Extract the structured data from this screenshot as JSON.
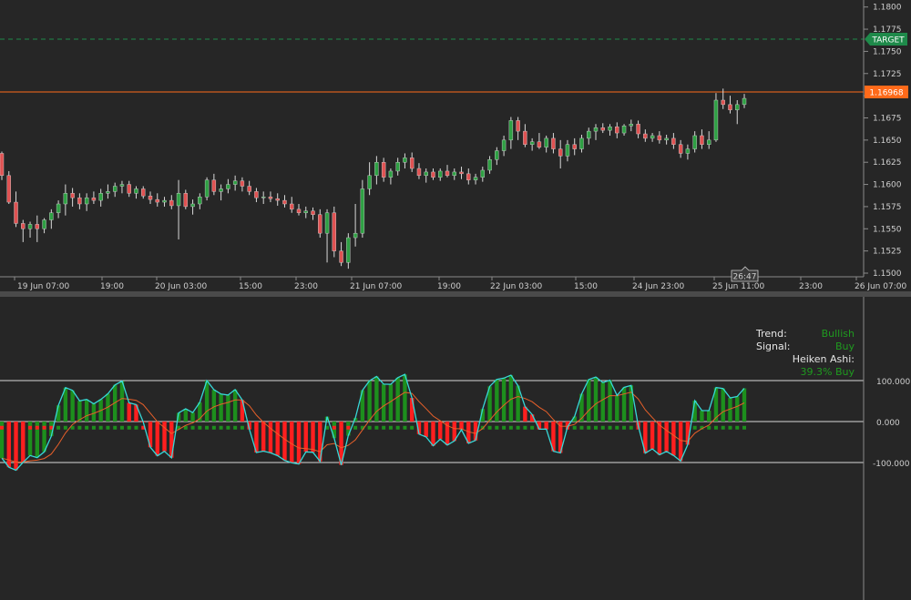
{
  "price_axis": {
    "ticks": [
      "1.1800",
      "1.1775",
      "1.1750",
      "1.1725",
      "1.1700",
      "1.1675",
      "1.1650",
      "1.1625",
      "1.1600",
      "1.1575",
      "1.1550",
      "1.1525",
      "1.1500"
    ]
  },
  "time_axis": {
    "ticks": [
      "19 Jun 07:00",
      "19:00",
      "20 Jun 03:00",
      "15:00",
      "23:00",
      "21 Jun 07:00",
      "19:00",
      "22 Jun 03:00",
      "15:00",
      "24 Jun 23:00",
      "25 Jun 11:00",
      "23:00",
      "26 Jun 07:00"
    ]
  },
  "target_label": "TARGET",
  "price_label": "1.16968",
  "countdown": "26:47",
  "osc_axis": {
    "ticks": [
      "100.000",
      "0.000",
      "-100.000"
    ]
  },
  "info_panel": {
    "trend_label": "Trend:",
    "trend_value": "Bullish",
    "signal_label": "Signal:",
    "signal_value": "Buy",
    "heiken_label": "Heiken Ashi:",
    "heiken_value": "39.3%  Buy"
  },
  "colors": {
    "background": "#262626",
    "bull": "#2ea043",
    "bear": "#e05252",
    "target": "#1e8a4a",
    "price_line": "#ff6a1a",
    "hist_green": "#1d8f1d",
    "hist_red": "#ff1f1f",
    "osc_fast": "#37d8d8",
    "osc_slow": "#e8602a"
  },
  "chart_data": {
    "type": "candlestick",
    "symbol_price_range": [
      1.15,
      1.1812
    ],
    "current_price": 1.16968,
    "target": 1.1753,
    "candles": [
      [
        1.1635,
        1.1637,
        1.1605,
        1.161
      ],
      [
        1.161,
        1.1615,
        1.1578,
        1.158
      ],
      [
        1.158,
        1.1592,
        1.1552,
        1.1556
      ],
      [
        1.1556,
        1.156,
        1.1535,
        1.155
      ],
      [
        1.155,
        1.1558,
        1.154,
        1.1555
      ],
      [
        1.1555,
        1.1565,
        1.1535,
        1.155
      ],
      [
        1.155,
        1.1562,
        1.1545,
        1.156
      ],
      [
        1.156,
        1.1572,
        1.155,
        1.1568
      ],
      [
        1.1568,
        1.1582,
        1.1562,
        1.1578
      ],
      [
        1.1578,
        1.16,
        1.1565,
        1.159
      ],
      [
        1.159,
        1.1596,
        1.1575,
        1.1585
      ],
      [
        1.1585,
        1.159,
        1.1572,
        1.1578
      ],
      [
        1.1578,
        1.159,
        1.157,
        1.1585
      ],
      [
        1.1585,
        1.1592,
        1.1578,
        1.1582
      ],
      [
        1.1582,
        1.1595,
        1.1575,
        1.159
      ],
      [
        1.159,
        1.16,
        1.1584,
        1.1592
      ],
      [
        1.1592,
        1.1602,
        1.1586,
        1.1598
      ],
      [
        1.1598,
        1.1604,
        1.159,
        1.16
      ],
      [
        1.16,
        1.1604,
        1.1586,
        1.159
      ],
      [
        1.159,
        1.1598,
        1.1584,
        1.1595
      ],
      [
        1.1595,
        1.1598,
        1.1584,
        1.1587
      ],
      [
        1.1587,
        1.1592,
        1.1578,
        1.1583
      ],
      [
        1.1583,
        1.159,
        1.1575,
        1.158
      ],
      [
        1.158,
        1.1586,
        1.1575,
        1.1582
      ],
      [
        1.1582,
        1.1588,
        1.1572,
        1.1576
      ],
      [
        1.1576,
        1.1605,
        1.1538,
        1.159
      ],
      [
        1.159,
        1.1594,
        1.1572,
        1.1575
      ],
      [
        1.1575,
        1.1583,
        1.1566,
        1.1578
      ],
      [
        1.1578,
        1.159,
        1.1572,
        1.1586
      ],
      [
        1.1586,
        1.1608,
        1.1582,
        1.1605
      ],
      [
        1.1605,
        1.1612,
        1.1588,
        1.1592
      ],
      [
        1.1592,
        1.16,
        1.1582,
        1.1595
      ],
      [
        1.1595,
        1.1606,
        1.159,
        1.16
      ],
      [
        1.16,
        1.161,
        1.1593,
        1.1604
      ],
      [
        1.1604,
        1.1608,
        1.1592,
        1.1598
      ],
      [
        1.1598,
        1.1604,
        1.1588,
        1.1592
      ],
      [
        1.1592,
        1.1596,
        1.158,
        1.1585
      ],
      [
        1.1585,
        1.1592,
        1.1578,
        1.1586
      ],
      [
        1.1586,
        1.1592,
        1.158,
        1.1584
      ],
      [
        1.1584,
        1.159,
        1.1576,
        1.1582
      ],
      [
        1.1582,
        1.1588,
        1.1574,
        1.1578
      ],
      [
        1.1578,
        1.1586,
        1.1568,
        1.1572
      ],
      [
        1.1572,
        1.1578,
        1.1565,
        1.1568
      ],
      [
        1.1568,
        1.1575,
        1.1562,
        1.157
      ],
      [
        1.157,
        1.1574,
        1.156,
        1.1566
      ],
      [
        1.1566,
        1.1572,
        1.154,
        1.1545
      ],
      [
        1.1545,
        1.1572,
        1.1512,
        1.1568
      ],
      [
        1.1568,
        1.1575,
        1.1518,
        1.1525
      ],
      [
        1.1525,
        1.1535,
        1.1508,
        1.1512
      ],
      [
        1.1512,
        1.1545,
        1.1505,
        1.154
      ],
      [
        1.154,
        1.1578,
        1.153,
        1.1545
      ],
      [
        1.1545,
        1.1605,
        1.154,
        1.1595
      ],
      [
        1.1595,
        1.1625,
        1.1588,
        1.161
      ],
      [
        1.161,
        1.1632,
        1.16,
        1.1625
      ],
      [
        1.1625,
        1.163,
        1.1603,
        1.1608
      ],
      [
        1.1608,
        1.1618,
        1.16,
        1.1615
      ],
      [
        1.1615,
        1.163,
        1.161,
        1.1625
      ],
      [
        1.1625,
        1.1635,
        1.1618,
        1.163
      ],
      [
        1.163,
        1.1636,
        1.1614,
        1.1618
      ],
      [
        1.1618,
        1.1624,
        1.1606,
        1.161
      ],
      [
        1.161,
        1.1618,
        1.1602,
        1.1614
      ],
      [
        1.1614,
        1.1618,
        1.1605,
        1.1608
      ],
      [
        1.1608,
        1.1618,
        1.1604,
        1.1615
      ],
      [
        1.1615,
        1.1622,
        1.1608,
        1.161
      ],
      [
        1.161,
        1.1618,
        1.1605,
        1.1614
      ],
      [
        1.1614,
        1.162,
        1.1606,
        1.1612
      ],
      [
        1.1612,
        1.1618,
        1.16,
        1.1605
      ],
      [
        1.1605,
        1.1612,
        1.16,
        1.1608
      ],
      [
        1.1608,
        1.162,
        1.1603,
        1.1616
      ],
      [
        1.1616,
        1.1632,
        1.1612,
        1.1628
      ],
      [
        1.1628,
        1.1642,
        1.1622,
        1.1638
      ],
      [
        1.1638,
        1.1655,
        1.1632,
        1.165
      ],
      [
        1.165,
        1.1676,
        1.164,
        1.1672
      ],
      [
        1.1672,
        1.1676,
        1.165,
        1.166
      ],
      [
        1.166,
        1.1668,
        1.1642,
        1.1645
      ],
      [
        1.1645,
        1.1652,
        1.1638,
        1.1648
      ],
      [
        1.1648,
        1.1658,
        1.164,
        1.1642
      ],
      [
        1.1642,
        1.1655,
        1.1636,
        1.1652
      ],
      [
        1.1652,
        1.1658,
        1.1635,
        1.164
      ],
      [
        1.164,
        1.165,
        1.1618,
        1.1632
      ],
      [
        1.1632,
        1.165,
        1.1626,
        1.1645
      ],
      [
        1.1645,
        1.1652,
        1.1633,
        1.164
      ],
      [
        1.164,
        1.1656,
        1.1636,
        1.1652
      ],
      [
        1.1652,
        1.1664,
        1.1645,
        1.166
      ],
      [
        1.166,
        1.1668,
        1.165,
        1.1664
      ],
      [
        1.1664,
        1.1669,
        1.1658,
        1.1661
      ],
      [
        1.1661,
        1.1668,
        1.1655,
        1.1665
      ],
      [
        1.1665,
        1.167,
        1.1652,
        1.1658
      ],
      [
        1.1658,
        1.1668,
        1.1655,
        1.1666
      ],
      [
        1.1666,
        1.1673,
        1.166,
        1.1668
      ],
      [
        1.1668,
        1.1672,
        1.1652,
        1.1657
      ],
      [
        1.1657,
        1.1662,
        1.1648,
        1.1652
      ],
      [
        1.1652,
        1.1658,
        1.1648,
        1.1655
      ],
      [
        1.1655,
        1.166,
        1.1646,
        1.165
      ],
      [
        1.165,
        1.1656,
        1.1645,
        1.1652
      ],
      [
        1.1652,
        1.1658,
        1.164,
        1.1645
      ],
      [
        1.1645,
        1.165,
        1.163,
        1.1635
      ],
      [
        1.1635,
        1.1645,
        1.1628,
        1.164
      ],
      [
        1.164,
        1.166,
        1.1636,
        1.1655
      ],
      [
        1.1655,
        1.1662,
        1.164,
        1.1645
      ],
      [
        1.1645,
        1.166,
        1.164,
        1.165
      ],
      [
        1.165,
        1.1703,
        1.1648,
        1.1695
      ],
      [
        1.1695,
        1.1708,
        1.1685,
        1.169
      ],
      [
        1.169,
        1.17,
        1.168,
        1.1684
      ],
      [
        1.1684,
        1.1695,
        1.1668,
        1.169
      ],
      [
        1.169,
        1.1702,
        1.1686,
        1.1697
      ]
    ],
    "oscillator": {
      "ylim": [
        -155,
        180
      ],
      "lines": [
        100,
        0,
        -100
      ],
      "signal_dots_level": -15
    }
  }
}
